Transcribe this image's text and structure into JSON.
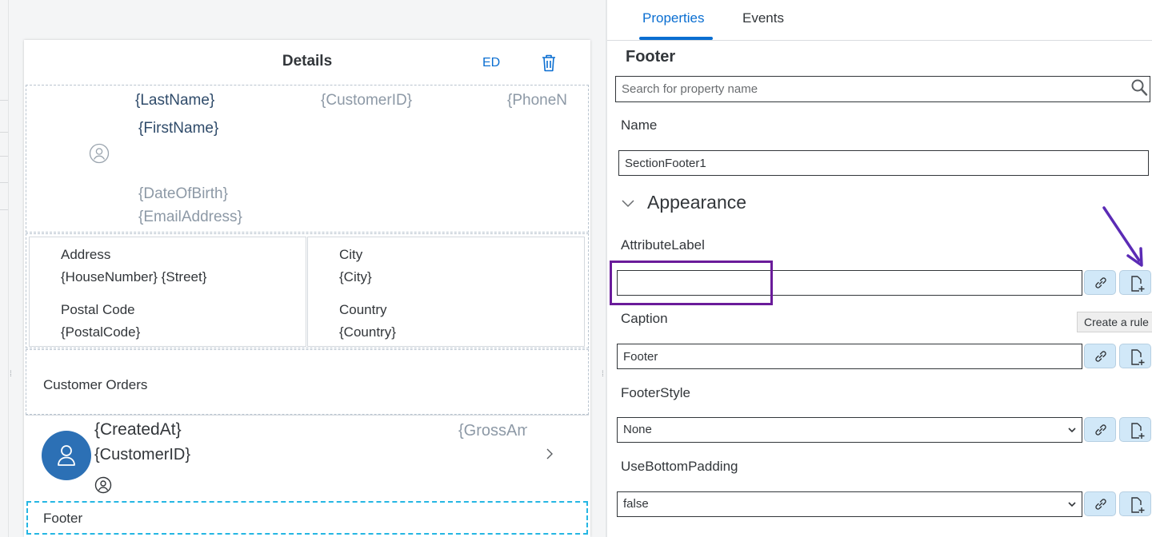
{
  "canvas": {
    "header": {
      "title": "Details",
      "action_label": "ED",
      "delete_icon": "trash-icon"
    },
    "object_header": {
      "last_name": "{LastName}",
      "customer_id": "{CustomerID}",
      "phone": "{PhoneN",
      "first_name": "{FirstName}",
      "date_of_birth": "{DateOfBirth}",
      "email": "{EmailAddress}",
      "avatar_icon": "user-circle-icon"
    },
    "key_values": [
      {
        "label": "Address",
        "value": "{HouseNumber} {Street}"
      },
      {
        "label": "City",
        "value": "{City}"
      },
      {
        "label": "Postal Code",
        "value": "{PostalCode}"
      },
      {
        "label": "Country",
        "value": "{Country}"
      }
    ],
    "orders_section": {
      "title": "Customer Orders"
    },
    "order_row": {
      "created_at": "{CreatedAt}",
      "customer_id": "{CustomerID}",
      "gross_amount": "{GrossAm",
      "avatar_icon": "user-icon",
      "chevron_icon": "chevron-right-icon"
    },
    "footer": {
      "label": "Footer"
    }
  },
  "properties_panel": {
    "tabs": [
      {
        "label": "Properties",
        "active": true
      },
      {
        "label": "Events",
        "active": false
      }
    ],
    "title": "Footer",
    "search": {
      "placeholder": "Search for property name",
      "value": ""
    },
    "name": {
      "label": "Name",
      "value": "SectionFooter1"
    },
    "appearance_section": "Appearance",
    "attribute_label": {
      "label": "AttributeLabel",
      "value": ""
    },
    "caption": {
      "label": "Caption",
      "value": "Footer"
    },
    "footer_style": {
      "label": "FooterStyle",
      "value": "None"
    },
    "use_bottom_padding": {
      "label": "UseBottomPadding",
      "value": "false"
    },
    "tooltip": "Create a rule",
    "icons": {
      "binding": "link-icon",
      "rule": "create-rule-icon"
    }
  },
  "colors": {
    "accent": "#0a6ed1",
    "annotation": "#6a1b9a",
    "selection": "#25b6e3",
    "avatar": "#2c70b5"
  }
}
